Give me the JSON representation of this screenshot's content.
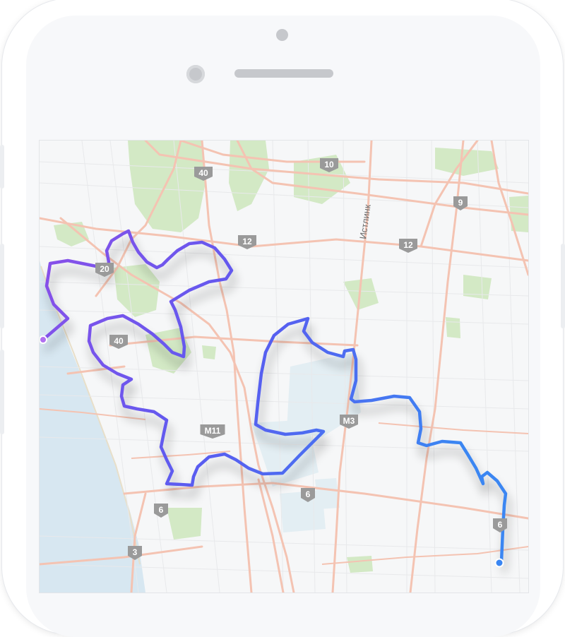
{
  "device": {
    "type": "smartphone"
  },
  "map": {
    "route_colors": {
      "start": "#8a4fe8",
      "middle": "#5a5cf0",
      "end": "#3a86f2"
    },
    "water_color": "#d7e7f1",
    "park_color": "#d3e9c5",
    "road_color": "#f4c3b2",
    "shield_color": "#9a9a9a",
    "shields": {
      "s40a": "40",
      "s10": "10",
      "s9": "9",
      "s12a": "12",
      "s12b": "12",
      "s20": "20",
      "s40b": "40",
      "sM11": "M11",
      "sM3": "M3",
      "s6a": "6",
      "s6b": "6",
      "s3": "3",
      "s_end": "6"
    },
    "road_name": "Истлинк",
    "markers": {
      "start": "route-start-marker",
      "end": "route-end-marker"
    }
  }
}
